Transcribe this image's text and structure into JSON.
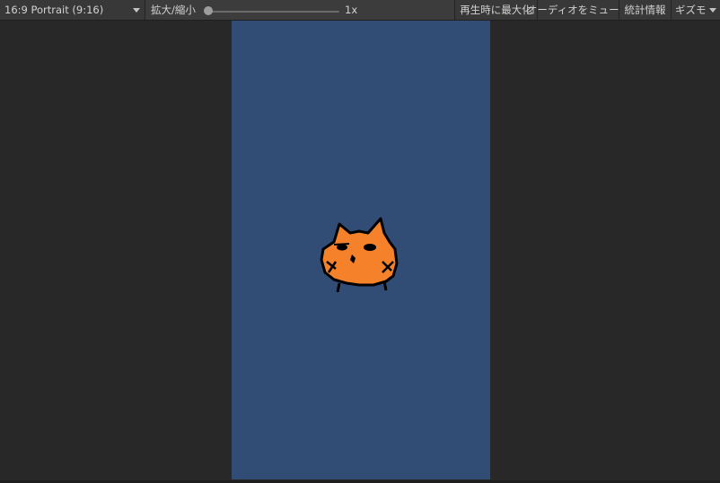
{
  "toolbar": {
    "aspect_ratio": "16:9 Portrait (9:16)",
    "scale_label": "拡大/縮小",
    "scale_value": "1x",
    "scale_slider_fraction": 0.0,
    "maximize_on_play": "再生時に最大化",
    "mute_audio": "オーディオをミュート",
    "stats": "統計情報",
    "gizmos": "ギズモ"
  },
  "game_view": {
    "background_color": "#314d76",
    "sprite": "orange-cat-sprite"
  },
  "colors": {
    "toolbar_bg": "#3c3c3c",
    "editor_bg": "#282828",
    "cat_orange": "#f5822a"
  }
}
